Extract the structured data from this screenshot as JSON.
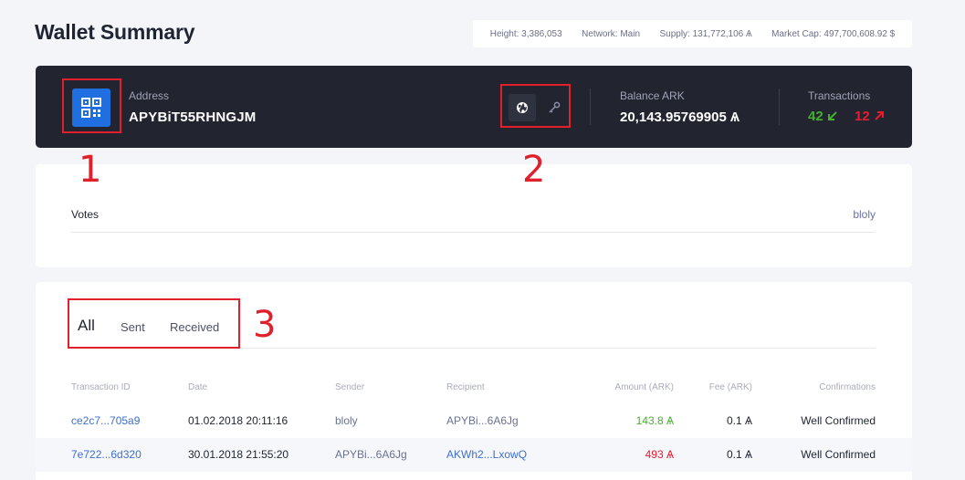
{
  "page": {
    "title": "Wallet Summary"
  },
  "stats": {
    "height": "Height: 3,386,053",
    "network": "Network: Main",
    "supply": "Supply: 131,772,106 Ѧ",
    "market_cap": "Market Cap: 497,700,608.92 $"
  },
  "wallet": {
    "address_label": "Address",
    "address": "APYBiT55RHNGJM",
    "balance_label": "Balance ARK",
    "balance": "20,143.95769905 Ѧ",
    "transactions_label": "Transactions",
    "received_count": "42",
    "sent_count": "12"
  },
  "votes": {
    "label": "Votes",
    "value": "bloly"
  },
  "tabs": {
    "all": "All",
    "sent": "Sent",
    "received": "Received"
  },
  "table": {
    "headers": [
      "Transaction ID",
      "Date",
      "Sender",
      "Recipient",
      "Amount (ARK)",
      "Fee (ARK)",
      "Confirmations"
    ],
    "rows": [
      {
        "id": "ce2c7...705a9",
        "date": "01.02.2018 20:11:16",
        "sender": "bloly",
        "recipient": "APYBi...6A6Jg",
        "amount": "143.8 Ѧ",
        "fee": "0.1 Ѧ",
        "confirmations": "Well Confirmed"
      },
      {
        "id": "7e722...6d320",
        "date": "30.01.2018 21:55:20",
        "sender": "APYBi...6A6Jg",
        "recipient": "AKWh2...LxowQ",
        "amount": "493 Ѧ",
        "fee": "0.1 Ѧ",
        "confirmations": "Well Confirmed"
      }
    ]
  },
  "annotations": [
    "1",
    "2",
    "3"
  ],
  "colors": {
    "accent": "#1f6fe0",
    "incoming": "#46b02e",
    "outgoing": "#ef192d",
    "annotation": "#e0202a"
  }
}
